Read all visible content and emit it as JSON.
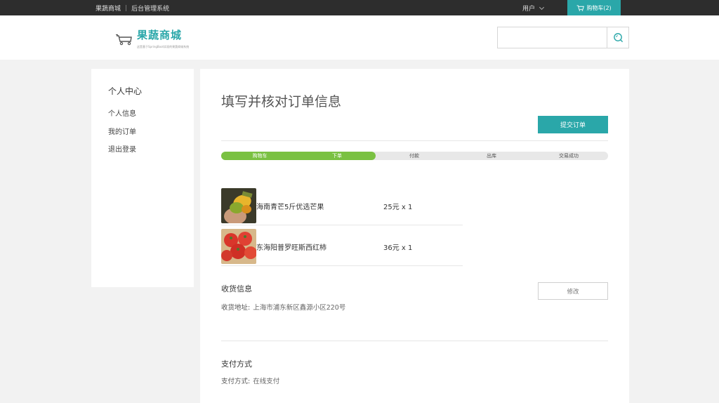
{
  "topbar": {
    "site_link": "果蔬商城",
    "separator": "|",
    "admin_link": "后台管理系统",
    "user_label": "用户",
    "cart_label": "购物车(2)"
  },
  "header": {
    "logo_title": "果蔬商城",
    "logo_subtitle": "这是基于SpringBoot实现的果蔬商城系统",
    "search_placeholder": ""
  },
  "sidebar": {
    "title": "个人中心",
    "items": [
      {
        "label": "个人信息"
      },
      {
        "label": "我的订单"
      },
      {
        "label": "退出登录"
      }
    ]
  },
  "main": {
    "page_title": "填写并核对订单信息",
    "submit_label": "提交订单",
    "progress": {
      "completed_fraction": 0.4,
      "steps": [
        {
          "label": "购物车",
          "done": true
        },
        {
          "label": "下单",
          "done": true
        },
        {
          "label": "付款",
          "done": false
        },
        {
          "label": "出库",
          "done": false
        },
        {
          "label": "交易成功",
          "done": false
        }
      ]
    },
    "items": [
      {
        "name": "海南青芒5斤优选芒果",
        "price": "25元 x 1",
        "image": "mango"
      },
      {
        "name": "东海阳普罗旺斯西红柿",
        "price": "36元 x 1",
        "image": "tomato"
      }
    ],
    "shipping": {
      "title": "收货信息",
      "address_label": "收货地址:",
      "address_value": "上海市浦东新区鑫源小区220号",
      "edit_label": "修改"
    },
    "payment": {
      "title": "支付方式",
      "method_label": "支付方式:",
      "method_value": "在线支付"
    }
  },
  "colors": {
    "accent": "#2aa7a9",
    "progress_done": "#7ac142",
    "topbar": "#2d2d2d"
  }
}
